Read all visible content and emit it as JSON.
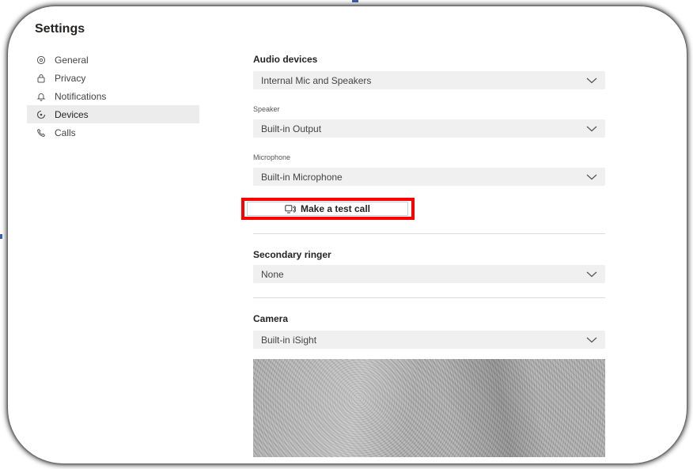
{
  "window": {
    "title": "Settings"
  },
  "sidebar": {
    "items": [
      {
        "label": "General",
        "icon": "gear-icon",
        "active": false
      },
      {
        "label": "Privacy",
        "icon": "lock-icon",
        "active": false
      },
      {
        "label": "Notifications",
        "icon": "bell-icon",
        "active": false
      },
      {
        "label": "Devices",
        "icon": "devices-icon",
        "active": true
      },
      {
        "label": "Calls",
        "icon": "phone-icon",
        "active": false
      }
    ]
  },
  "audio": {
    "title": "Audio devices",
    "selected": "Internal Mic and Speakers",
    "speaker_label": "Speaker",
    "speaker_value": "Built-in Output",
    "microphone_label": "Microphone",
    "microphone_value": "Built-in Microphone",
    "test_call_label": "Make a test call"
  },
  "secondary_ringer": {
    "title": "Secondary ringer",
    "value": "None"
  },
  "camera": {
    "title": "Camera",
    "value": "Built-in iSight"
  },
  "colors": {
    "highlight": "#ff0000",
    "active_nav": "#ececec",
    "dropdown_bg": "#f0f0f0"
  }
}
